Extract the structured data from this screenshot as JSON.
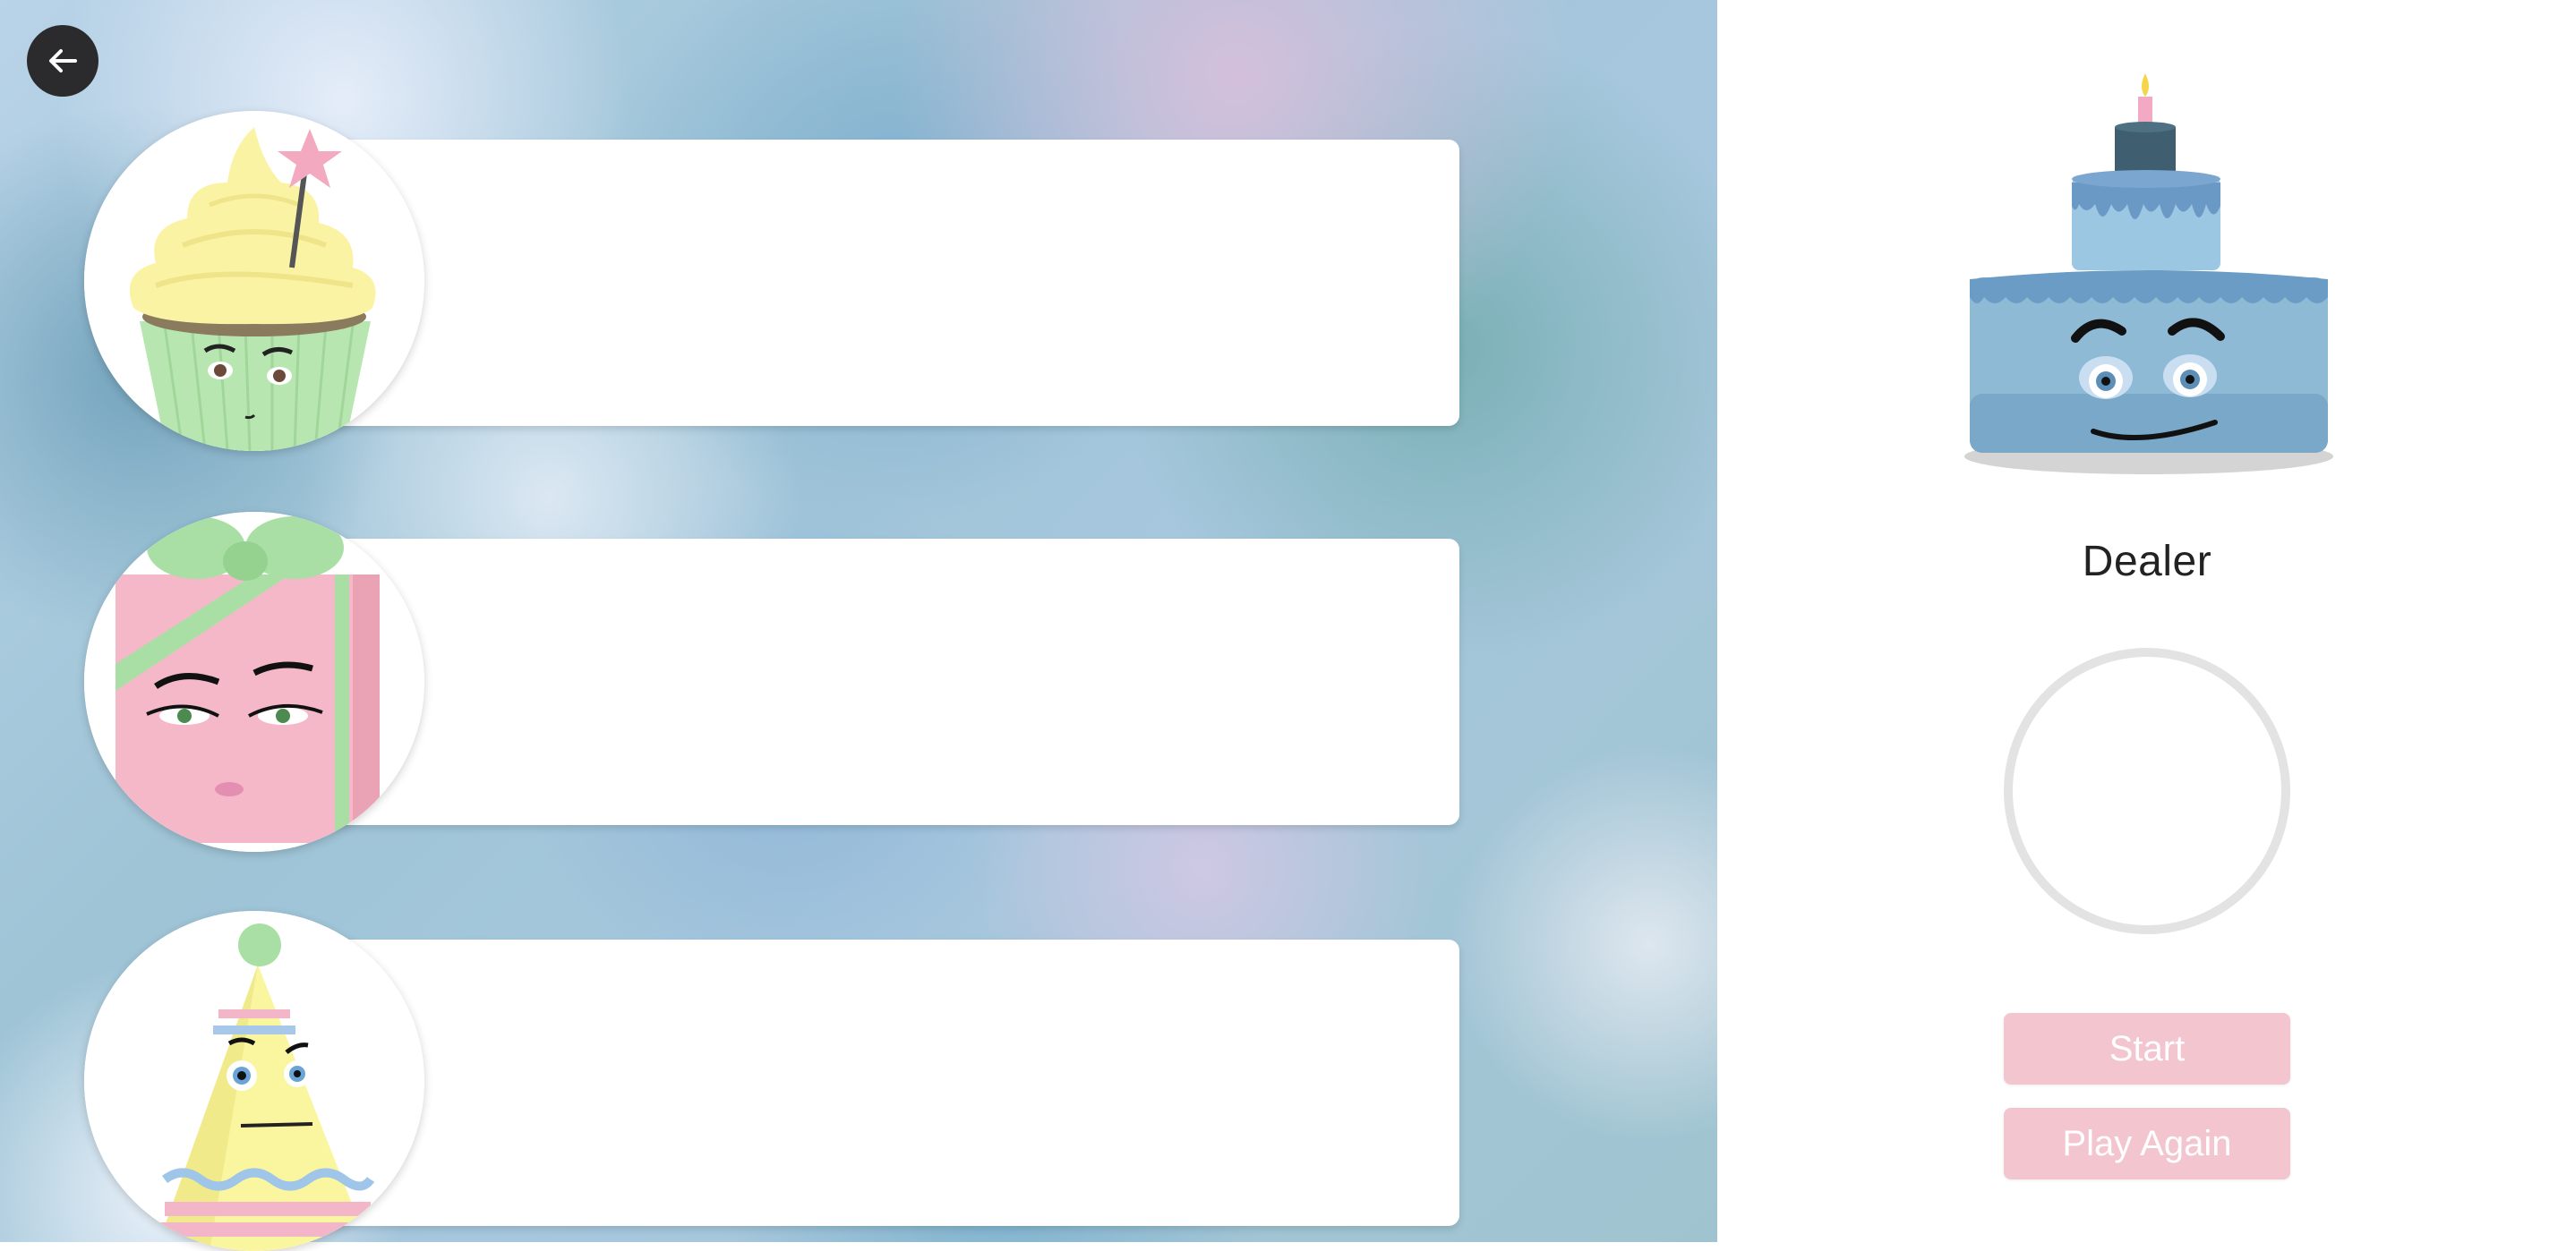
{
  "dealer": {
    "name": "Dealer",
    "avatar": "cake-icon"
  },
  "players": [
    {
      "avatar": "cupcake-icon"
    },
    {
      "avatar": "gift-box-icon"
    },
    {
      "avatar": "party-hat-icon"
    }
  ],
  "controls": {
    "back_icon": "arrow-left-icon",
    "start_label": "Start",
    "play_again_label": "Play Again"
  },
  "colors": {
    "button_pink": "#f3c5cf",
    "back_button_dark": "#2b2b2e",
    "cake_blue": "#8fbad6"
  }
}
